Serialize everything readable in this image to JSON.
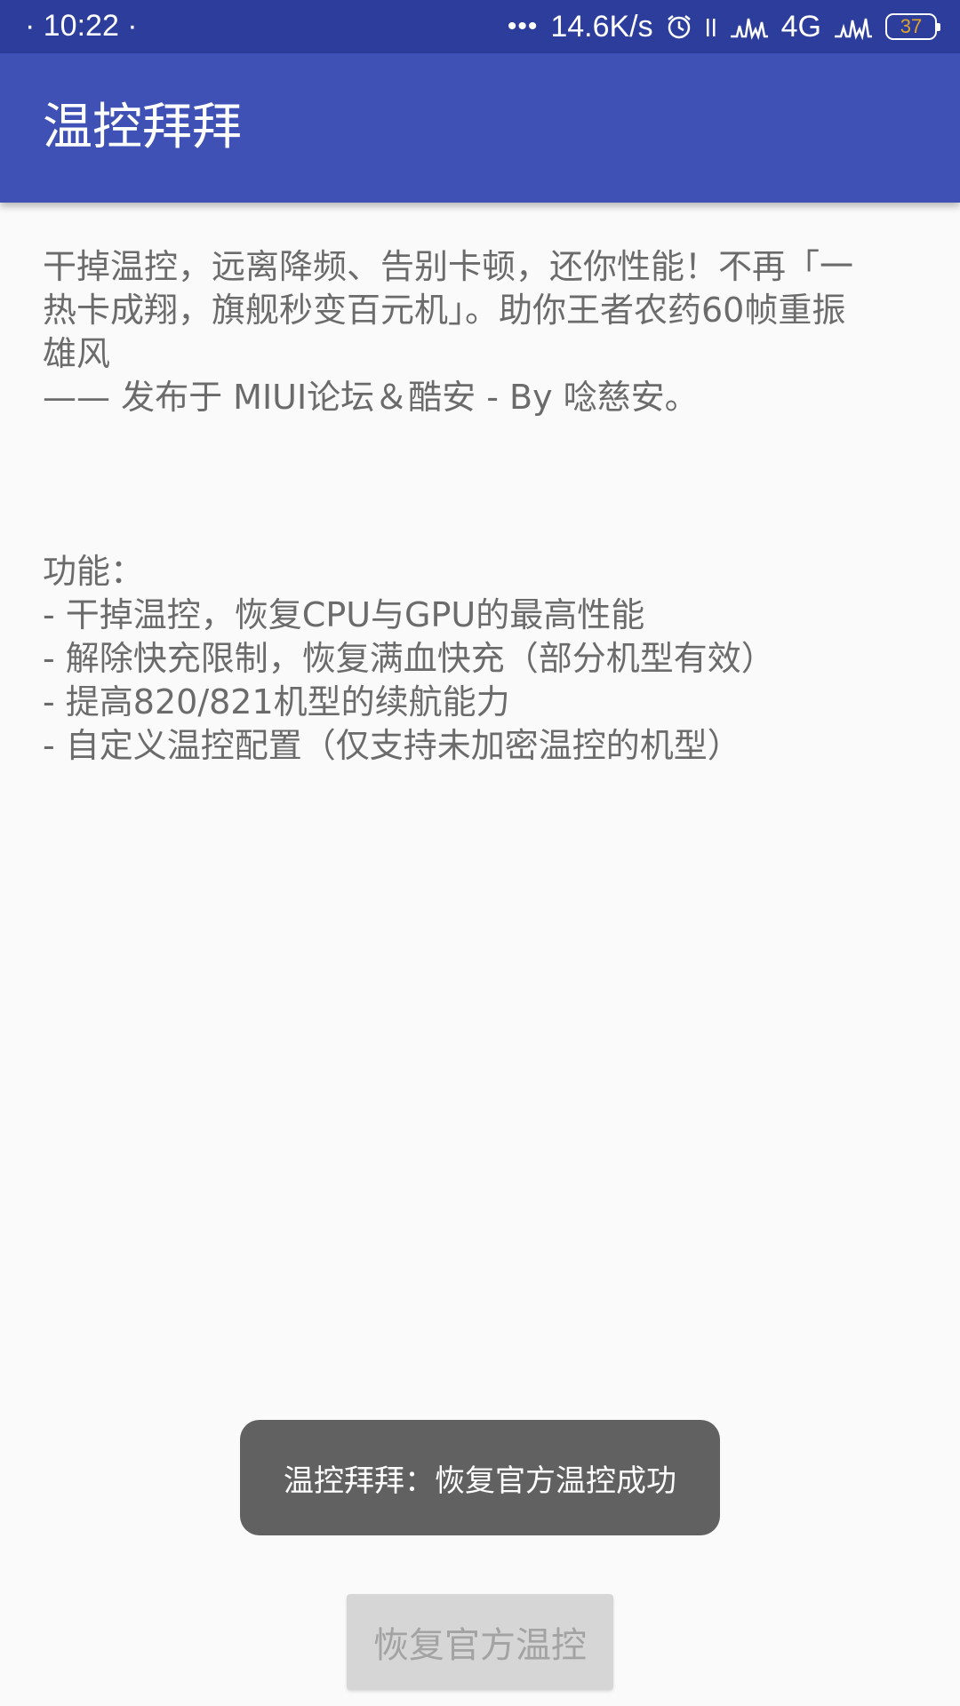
{
  "status_bar": {
    "time": "· 10:22 ·",
    "dots": "•••",
    "speed": "14.6K/s",
    "network": "4G",
    "battery": "37",
    "icons": [
      "alarm-icon",
      "signal-icon",
      "activity-icon",
      "signal-icon"
    ]
  },
  "app_bar": {
    "title": "温控拜拜"
  },
  "content": {
    "intro_lines": [
      "干掉温控，远离降频、告别卡顿，还你性能！不再「一",
      "热卡成翔，旗舰秒变百元机」。助你王者农药60帧重振",
      "雄风",
      "—— 发布于 MIUI论坛＆酷安 - By 唸慈安。"
    ],
    "features_heading": "功能：",
    "features": [
      "- 干掉温控，恢复CPU与GPU的最高性能",
      "- 解除快充限制，恢复满血快充（部分机型有效）",
      "- 提高820/821机型的续航能力",
      "- 自定义温控配置（仅支持未加密温控的机型）"
    ]
  },
  "toast": {
    "message": "温控拜拜：恢复官方温控成功"
  },
  "restore_button": {
    "label": "恢复官方温控"
  },
  "colors": {
    "status_bar": "#2d3d9c",
    "app_bar": "#3f51b5",
    "background": "#fafafa",
    "text": "#6b6b6b",
    "toast": "#616161",
    "button": "#d6d6d6",
    "battery_text": "#e0a32a"
  }
}
